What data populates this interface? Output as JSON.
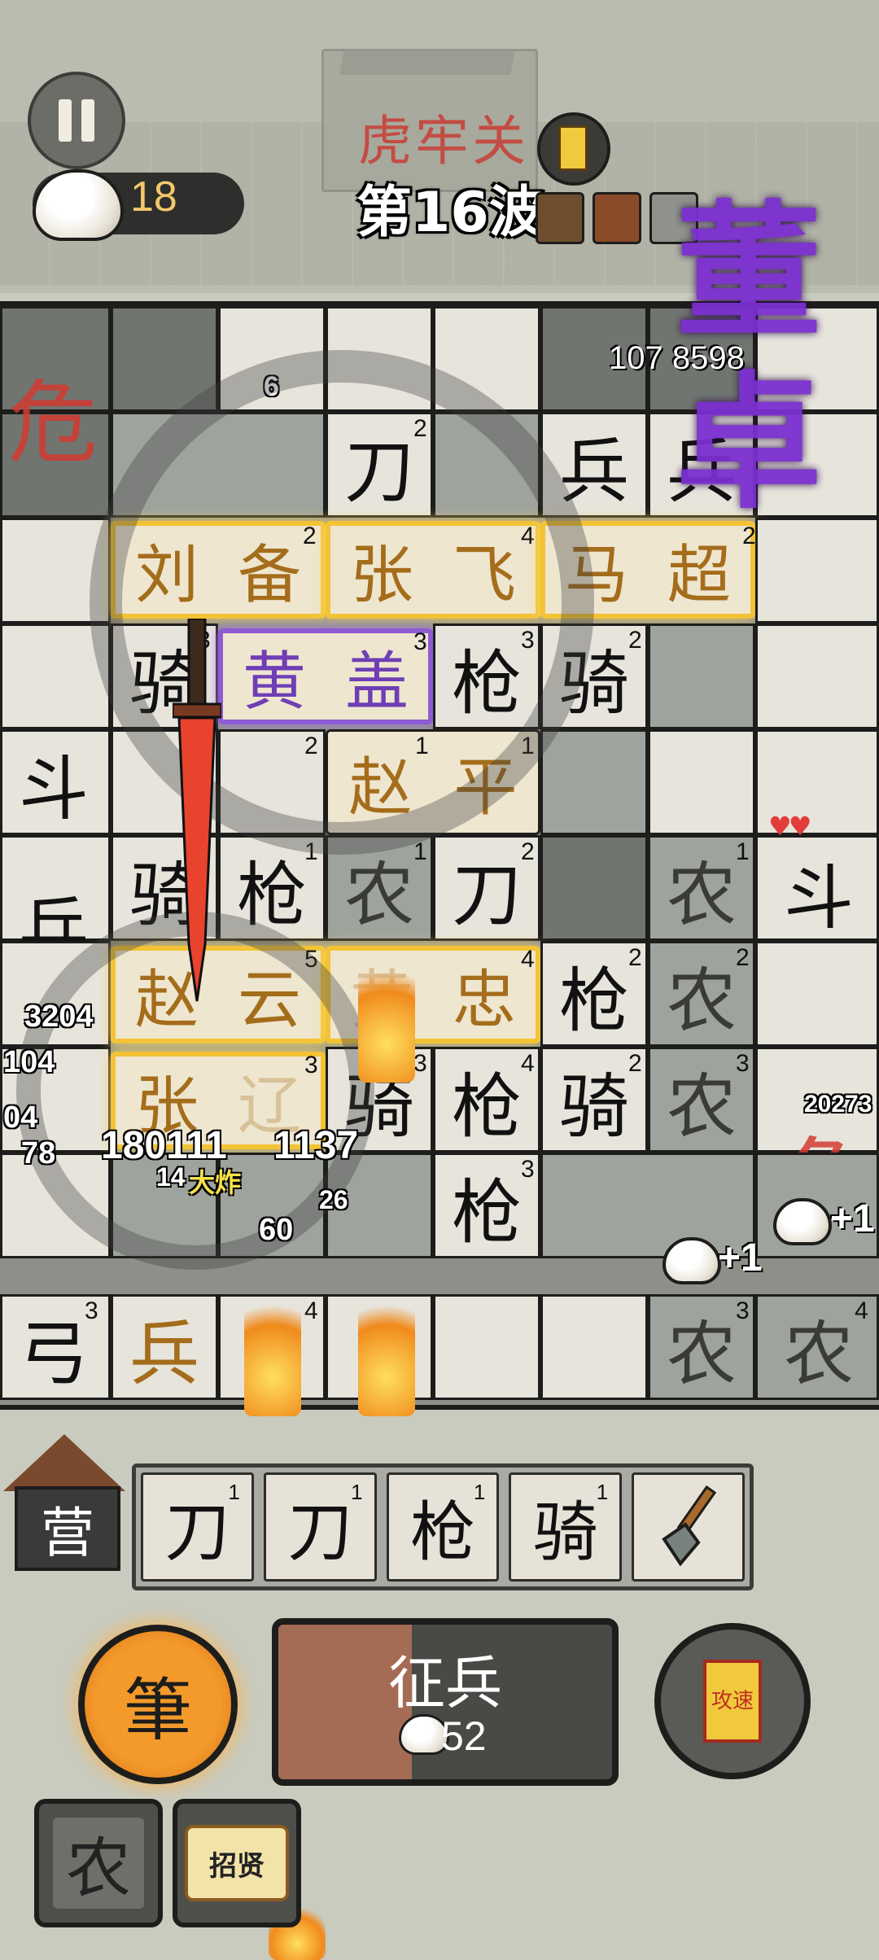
{
  "hud": {
    "level_name": "虎牢关",
    "wave_label": "第16波",
    "coins": "18",
    "boss_name": "董卓",
    "boss_hp": "107 8598"
  },
  "board": {
    "danger_text": "危",
    "row1": {
      "a": "刀",
      "a_lvl": "2",
      "b": "兵",
      "b2": "兵"
    },
    "generals_row": [
      "刘",
      "备",
      "张",
      "飞",
      "马",
      "超"
    ],
    "generals_lvl": [
      "2",
      "4",
      "2"
    ],
    "row3": {
      "qi": "骑",
      "huanggai": [
        "黄",
        "盖"
      ],
      "qiang": "枪",
      "qi2": "骑",
      "lvl": [
        "3",
        "3",
        "3",
        "2"
      ]
    },
    "row4": {
      "dou": "斗",
      "zhaoping": [
        "赵",
        "平"
      ],
      "lvl": [
        "3",
        "2",
        "1",
        "1"
      ]
    },
    "row5": {
      "bing": "兵",
      "qi": "骑",
      "qiang": "枪",
      "nong": "农",
      "dao": "刀",
      "nong2": "农",
      "dou": "斗",
      "lvl": [
        "2",
        "1",
        "1",
        "2",
        "1"
      ]
    },
    "row6": {
      "zhaoyun": [
        "赵",
        "云"
      ],
      "zhong": "忠",
      "qiang": "枪",
      "nong": "农",
      "lvl": [
        "5",
        "4",
        "2",
        "2"
      ]
    },
    "row7": {
      "zhang": "张",
      "qi": "骑",
      "qiang": "枪",
      "qi2": "骑",
      "nong": "农",
      "lvl": [
        "3",
        "3",
        "4",
        "2",
        "3"
      ]
    },
    "row8": {
      "qiang": "枪",
      "lvl": "3"
    },
    "row9": {
      "gong": "弓",
      "bing": "兵",
      "nong": "农",
      "nong2": "农",
      "lvl": [
        "3",
        "4",
        "3",
        "4"
      ]
    },
    "damage_numbers": [
      "6",
      "8",
      "3204",
      "104",
      "04",
      "78",
      "180111",
      "1137",
      "14",
      "大炸",
      "26",
      "60",
      "20273"
    ],
    "plus_labels": [
      "+1",
      "+1"
    ]
  },
  "bench": {
    "camp_label": "营",
    "slots": [
      {
        "char": "刀",
        "lvl": "1"
      },
      {
        "char": "刀",
        "lvl": "1"
      },
      {
        "char": "枪",
        "lvl": "1"
      },
      {
        "char": "骑",
        "lvl": "1"
      }
    ],
    "shovel_icon": "shovel-icon"
  },
  "actions": {
    "brush_label": "筆",
    "recruit_label": "征兵",
    "recruit_cost": "52",
    "speed_label": "攻速",
    "farmer_label": "农",
    "hire_label": "招贤"
  },
  "colors": {
    "gold_border": "#f3c335",
    "purple_border": "#8e5bd2",
    "boss_purple": "#7b2fd0",
    "danger_red": "#d23b32",
    "recruit_brown": "#a56c55"
  }
}
